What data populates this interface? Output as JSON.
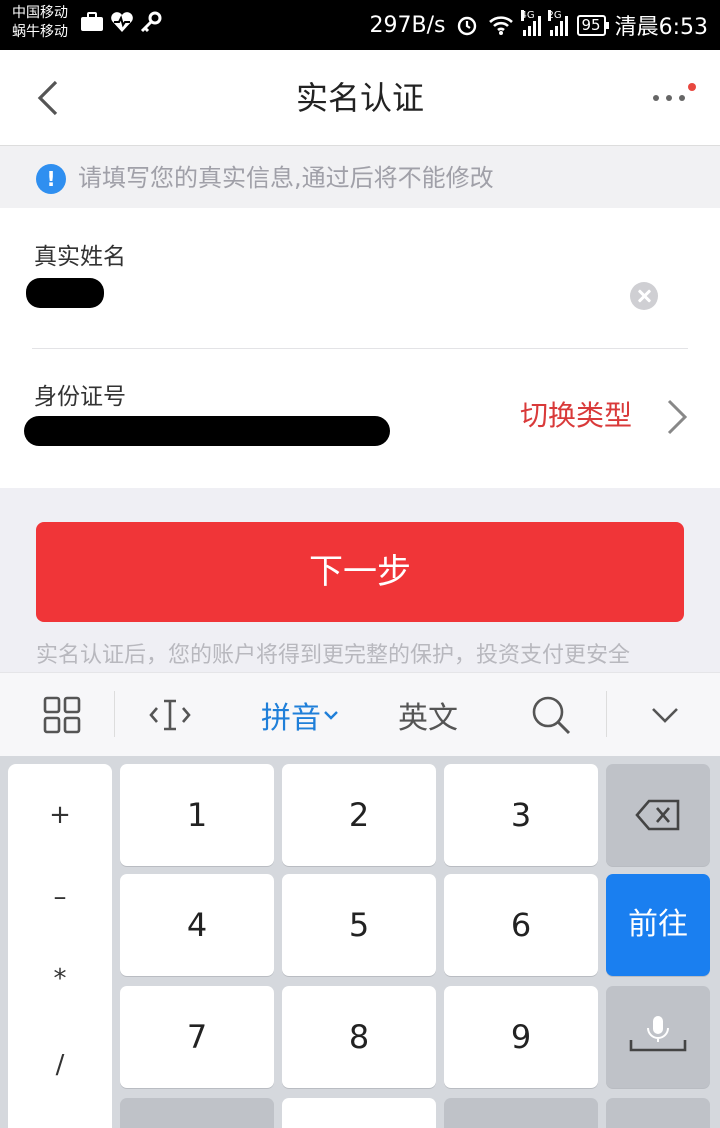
{
  "status_bar": {
    "carrier_1": "中国移动",
    "carrier_2": "蜗牛移动",
    "net_speed": "297B/s",
    "net_type_1": "4G",
    "net_type_2": "2G",
    "battery": "95",
    "time": "清晨6:53"
  },
  "nav": {
    "title": "实名认证"
  },
  "notice": {
    "text": "请填写您的真实信息,通过后将不能修改"
  },
  "form": {
    "name_label": "真实姓名",
    "id_label": "身份证号",
    "switch_type": "切换类型"
  },
  "next_button": "下一步",
  "footnote": "实名认证后，您的账户将得到更完整的保护，投资支付更安全",
  "keyboard": {
    "toolbar": {
      "pinyin": "拼音",
      "english": "英文"
    },
    "symbols": [
      "+",
      "–",
      "*",
      "/"
    ],
    "digits": [
      "1",
      "2",
      "3",
      "4",
      "5",
      "6",
      "7",
      "8",
      "9"
    ],
    "go": "前往"
  }
}
